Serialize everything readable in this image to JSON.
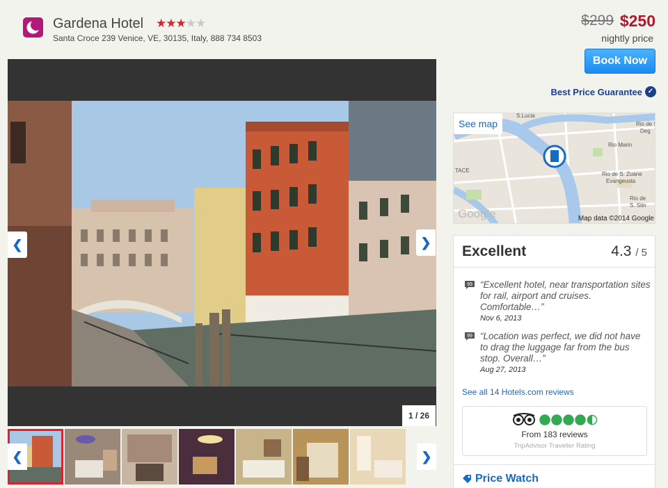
{
  "hotel": {
    "name": "Gardena Hotel",
    "stars": 3,
    "stars_max": 5,
    "address": "Santa Croce 239 Venice, VE, 30135, Italy, 888 734 8503",
    "logo_icon": "moon-logo-icon"
  },
  "pricing": {
    "old_price": "$299",
    "new_price": "$250",
    "nightly_label": "nightly price",
    "book_label": "Book Now",
    "guarantee_label": "Best Price Guarantee"
  },
  "gallery": {
    "counter": "1 / 26",
    "thumbnail_count": 7
  },
  "map": {
    "see_map_label": "See map",
    "credit": "Map data ©2014 Google",
    "labels": [
      "S.Lucia",
      "Rio de S. Zan Deg",
      "Rio Marin",
      "Rio de S. Zuane Evangeusta",
      "Rio de S. Stin",
      "Google",
      "TACE"
    ]
  },
  "reviews": {
    "rating_word": "Excellent",
    "score": "4.3",
    "score_max": "/ 5",
    "items": [
      {
        "text": "“Excellent hotel, near transportation sites for rail, airport and cruises. Comfortable…”",
        "date": "Nov 6, 2013"
      },
      {
        "text": "“Location was perfect, we did not have to drag the luggage far from the bus stop. Overall…”",
        "date": "Aug 27, 2013"
      }
    ],
    "see_all_label": "See all 14 Hotels.com reviews",
    "tripadvisor": {
      "bubbles": 5,
      "count_label": "From 183 reviews",
      "caption": "TripAdvisor Traveller Rating"
    },
    "price_watch_label": "Price Watch"
  },
  "colors": {
    "accent_red": "#d9232e",
    "price_red": "#b0172a",
    "link_blue": "#1769c1",
    "book_blue": "#1a8cf0",
    "ta_green": "#34a853",
    "logo_magenta": "#b21a7a"
  }
}
